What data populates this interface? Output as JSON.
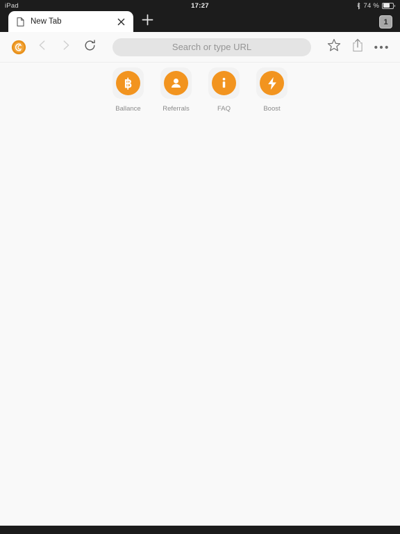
{
  "colors": {
    "accent": "#f2941f",
    "chrome_dark": "#1c1c1c",
    "page_background": "#f9f9f9",
    "tile_background": "#f2f2f2",
    "urlbar_background": "#e4e4e4",
    "label_text": "#8a8a8a"
  },
  "status_bar": {
    "device_label": "iPad",
    "clock": "17:27",
    "bluetooth_icon": "bluetooth-icon",
    "battery_percent": "74 %",
    "battery_icon": "battery-icon",
    "battery_level": 60
  },
  "tab_bar": {
    "tabs": [
      {
        "title": "New Tab",
        "page_icon": "page-icon",
        "close_icon": "close-icon",
        "active": true
      }
    ],
    "new_tab_icon": "plus-icon",
    "tab_count": "1"
  },
  "toolbar": {
    "brand_icon": "coin-logo-icon",
    "back_icon": "chevron-left-icon",
    "forward_icon": "chevron-right-icon",
    "reload_icon": "reload-icon",
    "bookmark_icon": "star-icon",
    "share_icon": "share-icon",
    "menu_icon": "more-dots-icon"
  },
  "search": {
    "value": "",
    "placeholder": "Search or type URL"
  },
  "shortcuts": [
    {
      "label": "Ballance",
      "icon": "bitcoin-icon"
    },
    {
      "label": "Referrals",
      "icon": "person-icon"
    },
    {
      "label": "FAQ",
      "icon": "info-icon"
    },
    {
      "label": "Boost",
      "icon": "lightning-bolt-icon"
    }
  ]
}
